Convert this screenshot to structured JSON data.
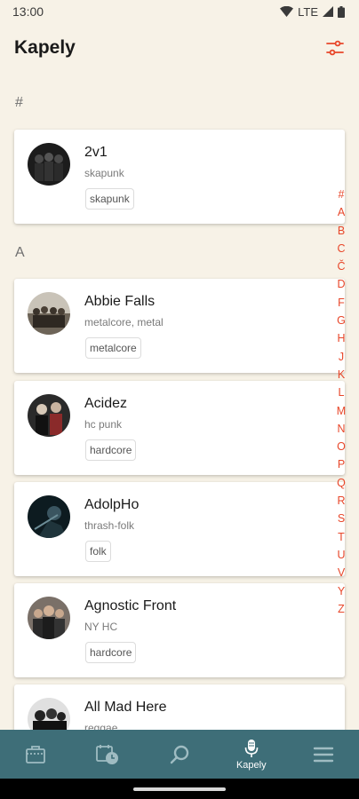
{
  "status_bar": {
    "time": "13:00",
    "network": "LTE"
  },
  "header": {
    "title": "Kapely"
  },
  "sections": [
    "#",
    "A"
  ],
  "bands": [
    {
      "name": "2v1",
      "genre": "skapunk",
      "tag": "skapunk"
    },
    {
      "name": "Abbie Falls",
      "genre": "metalcore, metal",
      "tag": "metalcore"
    },
    {
      "name": "Acidez",
      "genre": "hc punk",
      "tag": "hardcore"
    },
    {
      "name": "AdolpHo",
      "genre": "thrash-folk",
      "tag": "folk"
    },
    {
      "name": "Agnostic Front",
      "genre": "NY HC",
      "tag": "hardcore"
    },
    {
      "name": "All Mad Here",
      "genre": "reggae",
      "tag": ""
    }
  ],
  "alphabet": [
    "#",
    "A",
    "B",
    "C",
    "Č",
    "D",
    "F",
    "G",
    "H",
    "J",
    "K",
    "L",
    "M",
    "N",
    "O",
    "P",
    "Q",
    "R",
    "S",
    "T",
    "U",
    "V",
    "Y",
    "Z"
  ],
  "nav": [
    {
      "icon": "ticket-icon",
      "label": ""
    },
    {
      "icon": "calendar-clock-icon",
      "label": ""
    },
    {
      "icon": "search-icon",
      "label": ""
    },
    {
      "icon": "microphone-icon",
      "label": "Kapely"
    },
    {
      "icon": "menu-icon",
      "label": ""
    }
  ],
  "colors": {
    "background": "#f7f2e7",
    "accent": "#e8472a",
    "nav": "#3e6e78"
  }
}
